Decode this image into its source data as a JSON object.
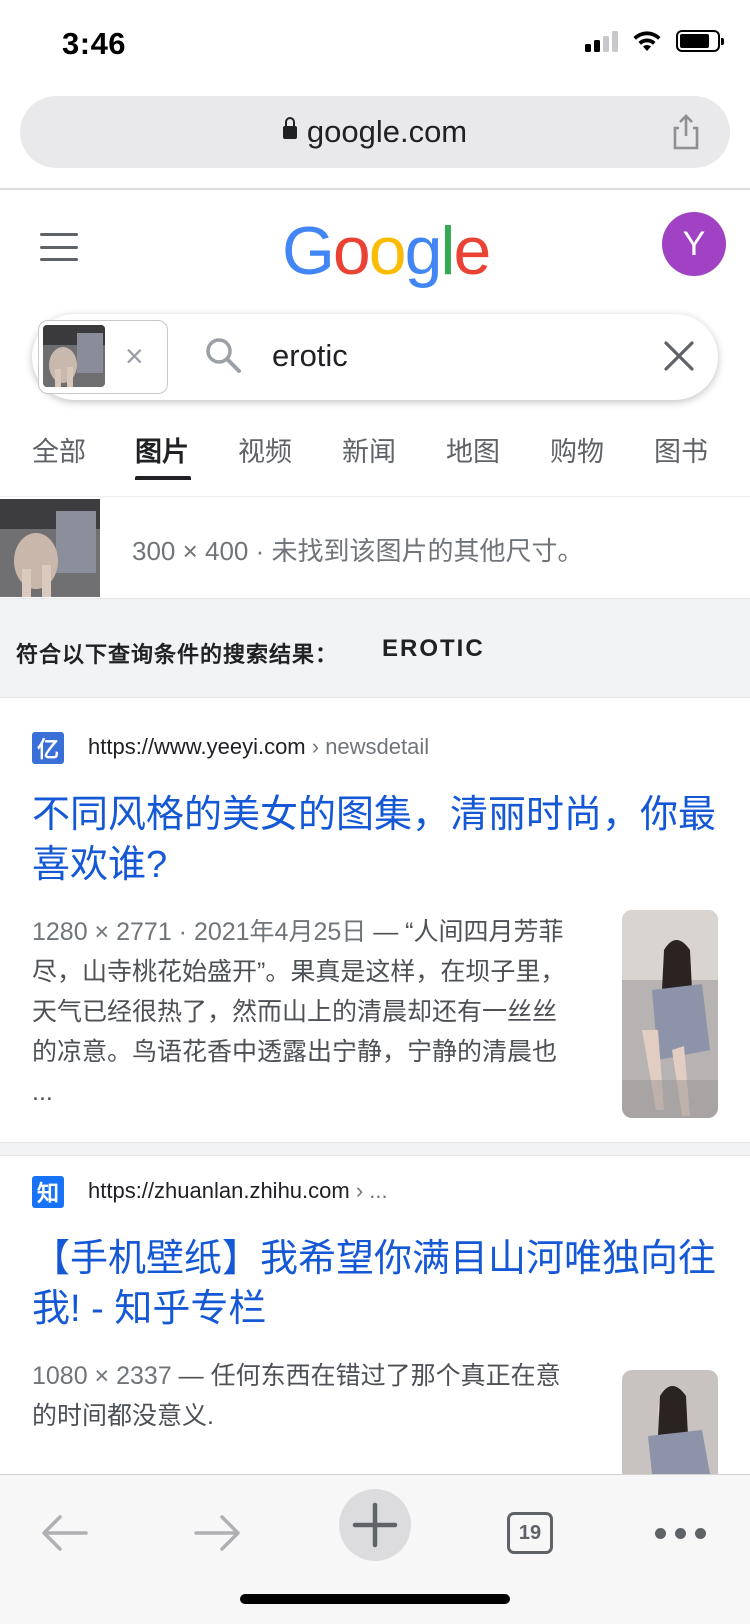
{
  "status_bar": {
    "time": "3:46",
    "icons": [
      "signal-icon",
      "wifi-icon",
      "battery-icon"
    ]
  },
  "browser": {
    "url": "google.com",
    "share_icon": "share-icon",
    "lock_icon": "lock-icon"
  },
  "header": {
    "logo": {
      "letters": [
        "G",
        "o",
        "o",
        "g",
        "l",
        "e"
      ],
      "colors": [
        "#4285F4",
        "#EA4335",
        "#FBBC05",
        "#4285F4",
        "#34A853",
        "#EA4335"
      ]
    },
    "avatar_initial": "Y",
    "avatar_color": "#a142c4"
  },
  "search": {
    "query": "erotic",
    "thumb_close": "×"
  },
  "tabs": [
    {
      "label": "全部",
      "active": false
    },
    {
      "label": "图片",
      "active": true
    },
    {
      "label": "视频",
      "active": false
    },
    {
      "label": "新闻",
      "active": false
    },
    {
      "label": "地图",
      "active": false
    },
    {
      "label": "购物",
      "active": false
    },
    {
      "label": "图书",
      "active": false
    }
  ],
  "image_info": {
    "text": "300 × 400 · 未找到该图片的其他尺寸。"
  },
  "query_banner": {
    "label": "符合以下查询条件的搜索结果：",
    "term": "EROTIC"
  },
  "results": [
    {
      "favicon_char": "亿",
      "favicon_color": "#3a6fd8",
      "url": "https://www.yeeyi.com",
      "crumb": " › newsdetail",
      "title": "不同风格的美女的图集，清丽时尚，你最喜欢谁?",
      "meta": "1280 × 2771 · 2021年4月25日",
      "snippet": " — “人间四月芳菲尽，山寺桃花始盛开”。果真是这样，在坝子里，天气已经很热了，然而山上的清晨却还有一丝丝的凉意。鸟语花香中透露出宁静，宁静的清晨也 ..."
    },
    {
      "favicon_char": "知",
      "favicon_color": "#1772f6",
      "url": "https://zhuanlan.zhihu.com",
      "crumb": " › ...",
      "title": "【手机壁纸】我希望你满目山河唯独向往我! - 知乎专栏",
      "meta": "1080 × 2337",
      "snippet": " — 任何东西在错过了那个真正在意的时间都没意义."
    }
  ],
  "toolbar": {
    "tab_count": "19",
    "icons": [
      "back-arrow-icon",
      "forward-arrow-icon",
      "plus-icon",
      "tab-count-icon",
      "more-dots-icon"
    ]
  }
}
